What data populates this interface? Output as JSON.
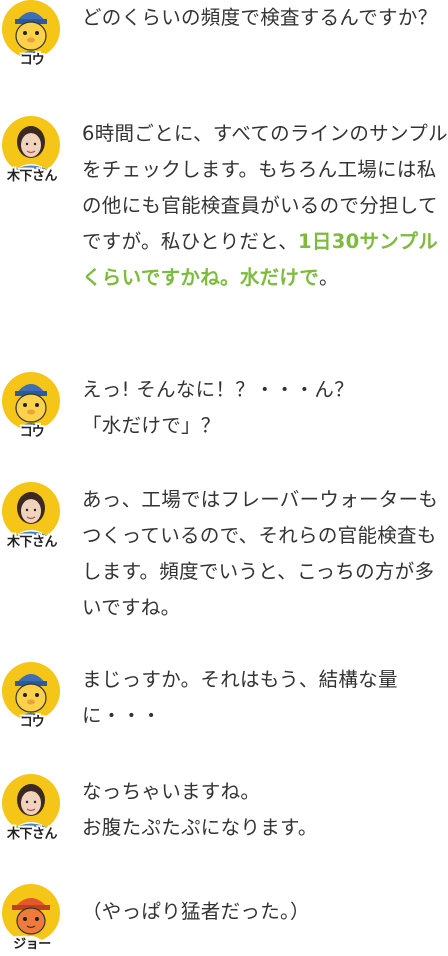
{
  "colors": {
    "text": "#333333",
    "highlight": "#7cbb3c",
    "kou_bg": "#f5c518",
    "joe_bg": "#f5c518",
    "kinoshita_bg": "#f5c518"
  },
  "dialog": [
    {
      "speaker": "コウ",
      "avatar_icon": "kou-mascot-icon",
      "segments": [
        {
          "text": "どのくらいの頻度で検査するんですか？",
          "highlight": false
        }
      ]
    },
    {
      "speaker": "木下さん",
      "avatar_icon": "kinoshita-photo-icon",
      "segments": [
        {
          "text": "6時間ごとに、すべてのラインのサンプルをチェックします。もちろん工場には私の他にも官能検査員がいるので分担してですが。私ひとりだと、",
          "highlight": false
        },
        {
          "text": "1日30サンプルくらいですかね。水だけで",
          "highlight": true
        },
        {
          "text": "。",
          "highlight": false
        }
      ]
    },
    {
      "speaker": "コウ",
      "avatar_icon": "kou-mascot-icon",
      "segments": [
        {
          "text": "えっ! そんなに！？・・・ん？",
          "highlight": false
        },
        {
          "text": "「水だけで」？",
          "highlight": false
        }
      ]
    },
    {
      "speaker": "木下さん",
      "avatar_icon": "kinoshita-photo-icon",
      "segments": [
        {
          "text": "あっ、工場ではフレーバーウォーターもつくっているので、それらの官能検査もします。頻度でいうと、こっちの方が多いですね。",
          "highlight": false
        }
      ]
    },
    {
      "speaker": "コウ",
      "avatar_icon": "kou-mascot-icon",
      "segments": [
        {
          "text": "まじっすか。それはもう、結構な量に・・・",
          "highlight": false
        }
      ]
    },
    {
      "speaker": "木下さん",
      "avatar_icon": "kinoshita-photo-icon",
      "segments": [
        {
          "text": "なっちゃいますね。",
          "highlight": false
        },
        {
          "text": "お腹たぷたぷになります。",
          "highlight": false
        }
      ]
    },
    {
      "speaker": "ジョー",
      "avatar_icon": "joe-mascot-icon",
      "segments": [
        {
          "text": "（やっぱり猛者だった。）",
          "highlight": false
        }
      ]
    }
  ]
}
